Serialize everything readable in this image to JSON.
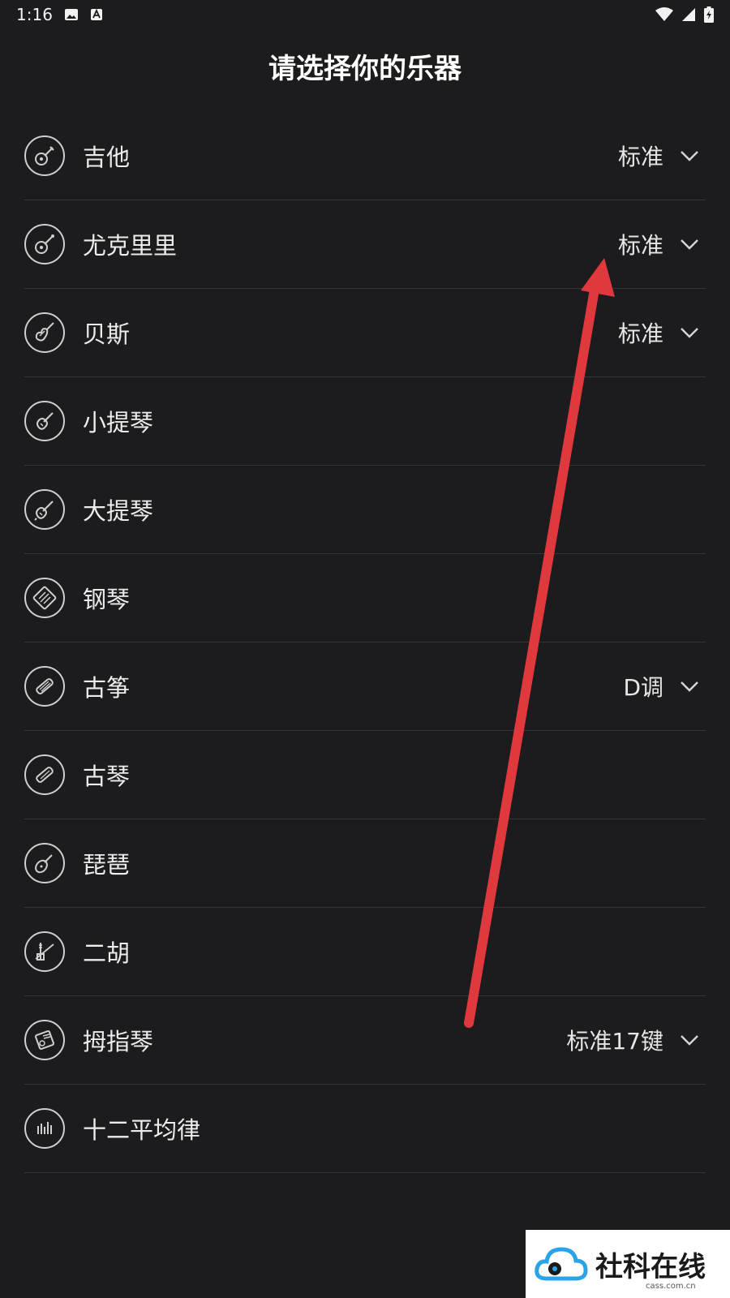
{
  "status_bar": {
    "time": "1:16",
    "icons": [
      "image-icon",
      "a-icon",
      "wifi-icon",
      "signal-icon",
      "battery-icon"
    ]
  },
  "title": "请选择你的乐器",
  "instruments": [
    {
      "label": "吉他",
      "icon": "guitar-icon",
      "value": "标准",
      "has_dropdown": true
    },
    {
      "label": "尤克里里",
      "icon": "ukulele-icon",
      "value": "标准",
      "has_dropdown": true
    },
    {
      "label": "贝斯",
      "icon": "bass-icon",
      "value": "标准",
      "has_dropdown": true
    },
    {
      "label": "小提琴",
      "icon": "violin-icon",
      "value": "",
      "has_dropdown": false
    },
    {
      "label": "大提琴",
      "icon": "cello-icon",
      "value": "",
      "has_dropdown": false
    },
    {
      "label": "钢琴",
      "icon": "piano-icon",
      "value": "",
      "has_dropdown": false
    },
    {
      "label": "古筝",
      "icon": "guzheng-icon",
      "value": "D调",
      "has_dropdown": true
    },
    {
      "label": "古琴",
      "icon": "guqin-icon",
      "value": "",
      "has_dropdown": false
    },
    {
      "label": "琵琶",
      "icon": "pipa-icon",
      "value": "",
      "has_dropdown": false
    },
    {
      "label": "二胡",
      "icon": "erhu-icon",
      "value": "",
      "has_dropdown": false
    },
    {
      "label": "拇指琴",
      "icon": "kalimba-icon",
      "value": "标准17键",
      "has_dropdown": true
    },
    {
      "label": "十二平均律",
      "icon": "equal-temperament-icon",
      "value": "",
      "has_dropdown": false
    }
  ],
  "watermark": {
    "text": "社科在线",
    "sub": "cass.com.cn"
  },
  "colors": {
    "background": "#1c1c1e",
    "arrow": "#e0393d",
    "divider": "#34343a"
  }
}
